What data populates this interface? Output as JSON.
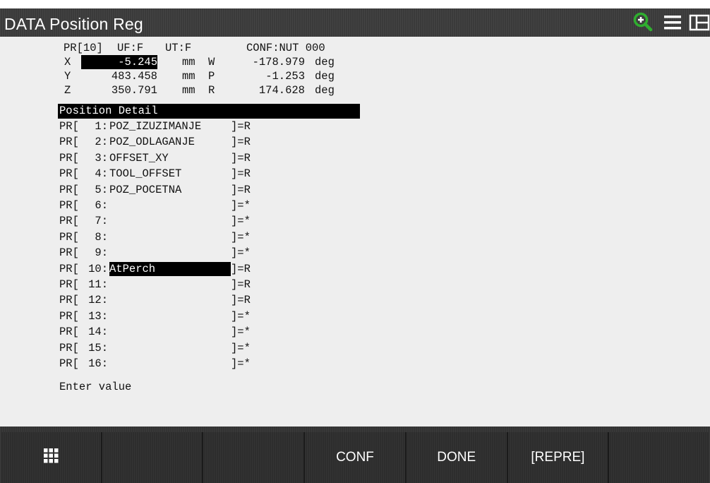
{
  "window": {
    "title": "DATA Position Reg",
    "icons": [
      "zoom-in-icon",
      "menu-icon",
      "split-view-icon"
    ],
    "accent_color": "#2fae2f"
  },
  "position": {
    "header": {
      "pr": "PR[10]",
      "uf": "UF:F",
      "ut": "UT:F",
      "conf": "CONF:NUT 000"
    },
    "rows": [
      {
        "axis": "X",
        "value": "-5.245",
        "unit": "mm",
        "raxis": "W",
        "rvalue": "-178.979",
        "runit": "deg"
      },
      {
        "axis": "Y",
        "value": "483.458",
        "unit": "mm",
        "raxis": "P",
        "rvalue": "-1.253",
        "runit": "deg"
      },
      {
        "axis": "Z",
        "value": "350.791",
        "unit": "mm",
        "raxis": "R",
        "rvalue": "174.628",
        "runit": "deg"
      }
    ]
  },
  "detail_header": "Position Detail",
  "registers": [
    {
      "prefix": "PR[",
      "index": "1:",
      "name": "POZ_IZUZIMANJE",
      "suffix": "]=R"
    },
    {
      "prefix": "PR[",
      "index": "2:",
      "name": "POZ_ODLAGANJE",
      "suffix": "]=R"
    },
    {
      "prefix": "PR[",
      "index": "3:",
      "name": "OFFSET_XY",
      "suffix": "]=R"
    },
    {
      "prefix": "PR[",
      "index": "4:",
      "name": "TOOL_OFFSET",
      "suffix": "]=R"
    },
    {
      "prefix": "PR[",
      "index": "5:",
      "name": "POZ_POCETNA",
      "suffix": "]=R"
    },
    {
      "prefix": "PR[",
      "index": "6:",
      "name": "",
      "suffix": "]=*"
    },
    {
      "prefix": "PR[",
      "index": "7:",
      "name": "",
      "suffix": "]=*"
    },
    {
      "prefix": "PR[",
      "index": "8:",
      "name": "",
      "suffix": "]=*"
    },
    {
      "prefix": "PR[",
      "index": "9:",
      "name": "",
      "suffix": "]=*"
    },
    {
      "prefix": "PR[",
      "index": "10:",
      "name": "AtPerch",
      "suffix": "]=R",
      "selected": true
    },
    {
      "prefix": "PR[",
      "index": "11:",
      "name": "",
      "suffix": "]=R"
    },
    {
      "prefix": "PR[",
      "index": "12:",
      "name": "",
      "suffix": "]=R"
    },
    {
      "prefix": "PR[",
      "index": "13:",
      "name": "",
      "suffix": "]=*"
    },
    {
      "prefix": "PR[",
      "index": "14:",
      "name": "",
      "suffix": "]=*"
    },
    {
      "prefix": "PR[",
      "index": "15:",
      "name": "",
      "suffix": "]=*"
    },
    {
      "prefix": "PR[",
      "index": "16:",
      "name": "",
      "suffix": "]=*"
    }
  ],
  "prompt": "Enter value",
  "function_keys": [
    {
      "label": "",
      "icon": "grid-icon"
    },
    {
      "label": ""
    },
    {
      "label": ""
    },
    {
      "label": "CONF"
    },
    {
      "label": "DONE"
    },
    {
      "label": "[REPRE]"
    },
    {
      "label": ""
    }
  ]
}
